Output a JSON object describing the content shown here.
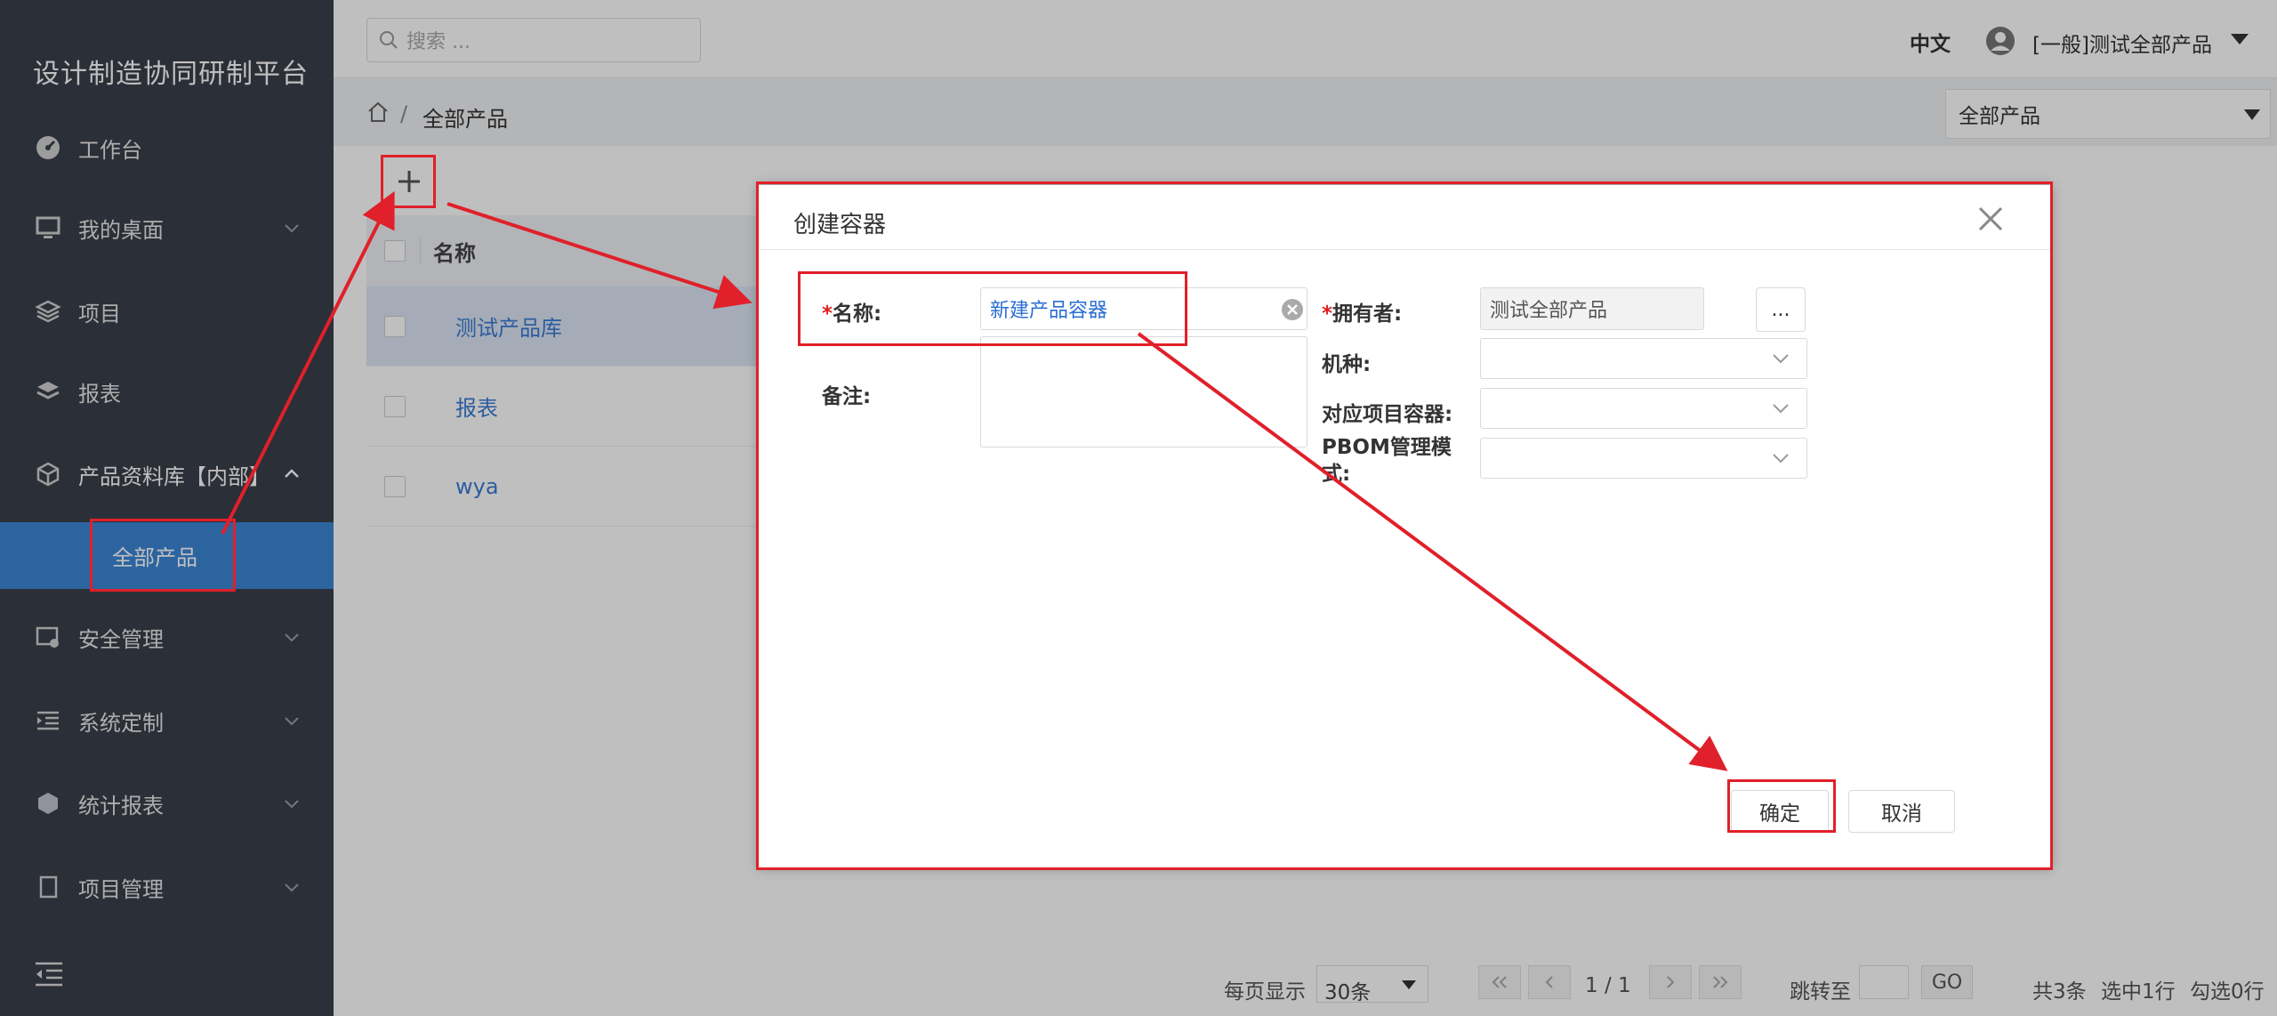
{
  "app": {
    "brand": "设计制造协同研制平台"
  },
  "sidebar": {
    "items": [
      {
        "label": "工作台",
        "icon": "dashboard-icon"
      },
      {
        "label": "我的桌面",
        "icon": "monitor-icon"
      },
      {
        "label": "项目",
        "icon": "layers-icon"
      },
      {
        "label": "报表",
        "icon": "report-icon"
      },
      {
        "label": "产品资料库【内部】",
        "icon": "cube-icon"
      },
      {
        "label": "全部产品",
        "icon": "circle-icon"
      },
      {
        "label": "安全管理",
        "icon": "security-icon"
      },
      {
        "label": "系统定制",
        "icon": "menu-indent-icon"
      },
      {
        "label": "统计报表",
        "icon": "hexagon-icon"
      },
      {
        "label": "项目管理",
        "icon": "document-icon"
      }
    ]
  },
  "header": {
    "search_placeholder": "搜索 ...",
    "lang": "中文",
    "user": "[一般]测试全部产品"
  },
  "breadcrumb": {
    "separator": "/",
    "current": "全部产品",
    "select_value": "全部产品"
  },
  "table": {
    "header_name": "名称",
    "rows": [
      "测试产品库",
      "报表",
      "wya"
    ]
  },
  "pager": {
    "per_page_label": "每页显示",
    "per_page_value": "30条",
    "page": "1 / 1",
    "jump_label": "跳转至",
    "go": "GO",
    "total": "共3条",
    "selected": "选中1行",
    "checked": "勾选0行"
  },
  "dialog": {
    "title": "创建容器",
    "required_mark": "*",
    "name_label": "名称:",
    "name_value": "新建产品容器",
    "note_label": "备注:",
    "owner_label": "拥有者:",
    "owner_value": "测试全部产品",
    "dots": "...",
    "model_label": "机种:",
    "project_container_label": "对应项目容器:",
    "pbom_label": "PBOM管理模式:",
    "ok": "确定",
    "cancel": "取消"
  },
  "colors": {
    "sidebar_bg": "#3a3f4b",
    "active": "#3b86d6",
    "annotation": "#e0202a",
    "link": "#3a7bd5"
  }
}
